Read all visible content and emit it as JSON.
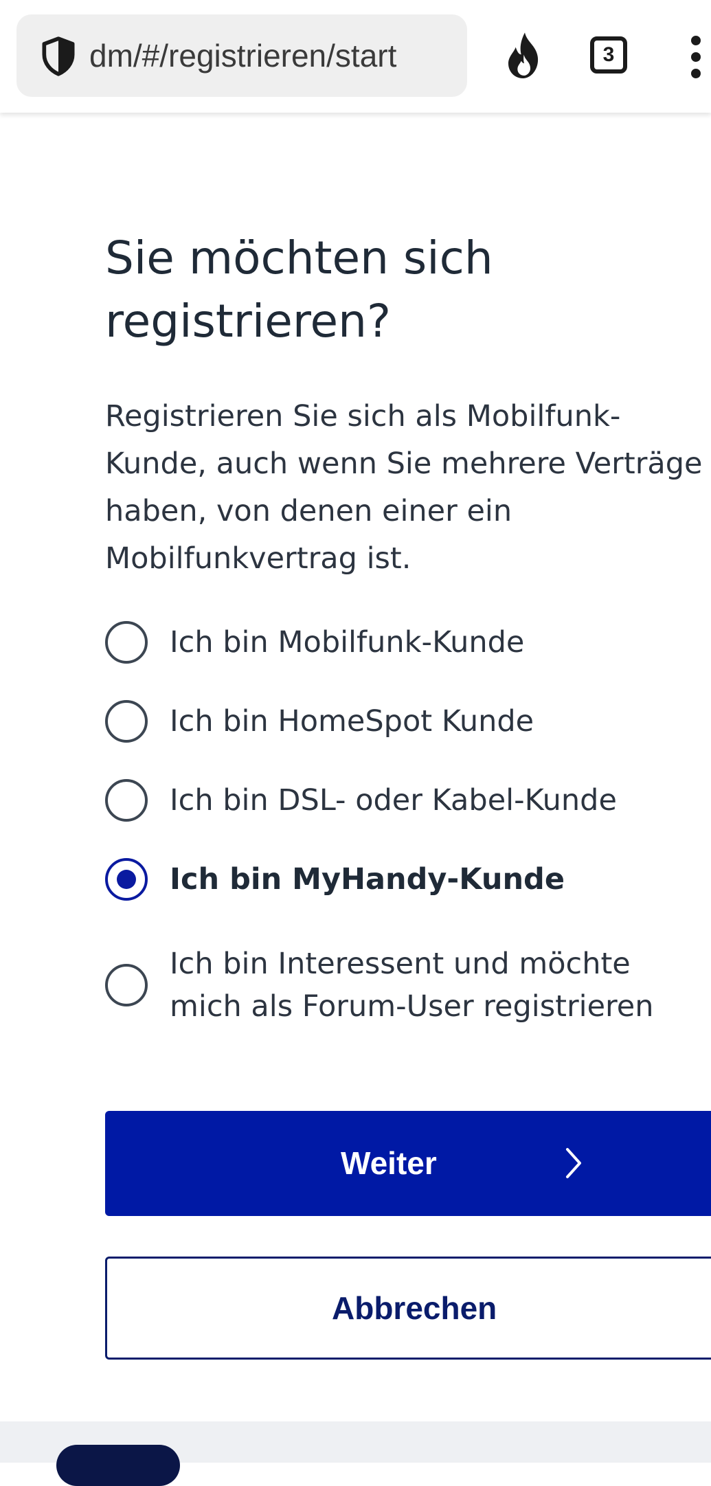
{
  "browser": {
    "url": "dm/#/registrieren/start",
    "tab_count": "3"
  },
  "page": {
    "title": "Sie möchten sich registrieren?",
    "intro": "Registrieren Sie sich als Mobilfunk-Kunde, auch wenn Sie mehrere Verträge haben, von denen einer ein Mobilfunkvertrag ist."
  },
  "options": [
    {
      "label": "Ich bin Mobilfunk-Kunde",
      "selected": false
    },
    {
      "label": "Ich bin HomeSpot Kunde",
      "selected": false
    },
    {
      "label": "Ich bin DSL- oder Kabel-Kunde",
      "selected": false
    },
    {
      "label": "Ich bin MyHandy-Kunde",
      "selected": true
    },
    {
      "label": "Ich bin Interessent und möchte mich als Forum-User registrieren",
      "selected": false
    }
  ],
  "buttons": {
    "next_label": "Weiter",
    "cancel_label": "Abbrechen"
  },
  "colors": {
    "primary": "#0019a5",
    "secondary_border": "#0a1c6b",
    "radio_selected": "#0a1aa0"
  }
}
